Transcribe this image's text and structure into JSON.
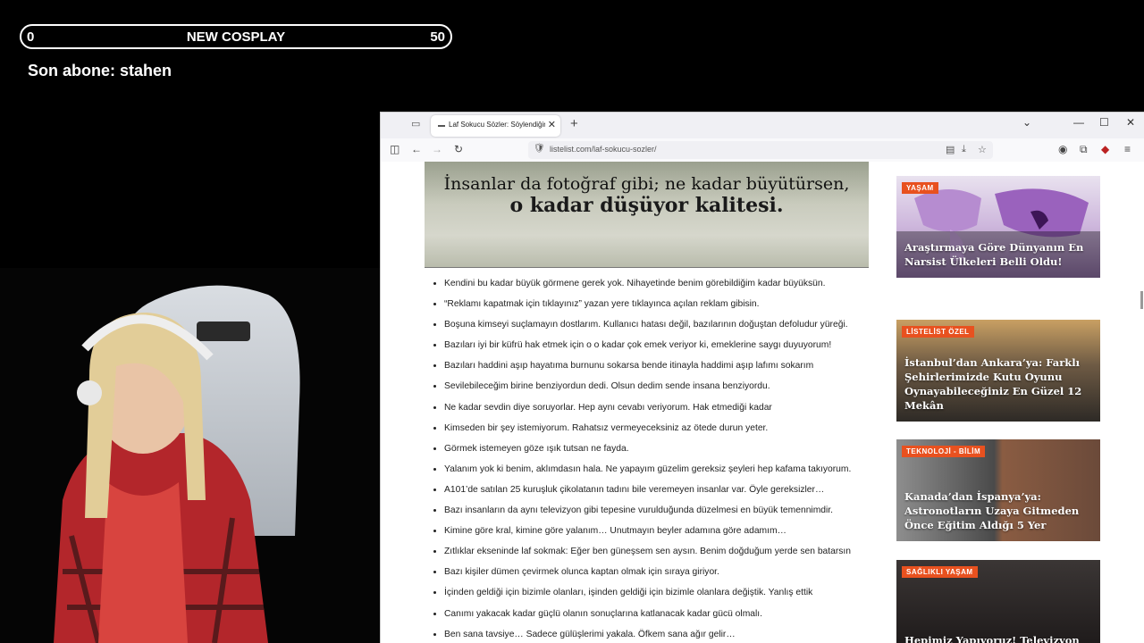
{
  "overlay": {
    "goal_min": "0",
    "goal_title": "NEW COSPLAY",
    "goal_max": "50",
    "last_sub": "Son abone: stahen"
  },
  "browser": {
    "tab_title": "Laf Sokucu Sözler: Söylendiğinde",
    "url": "listelist.com/laf-sokucu-sozler/"
  },
  "article": {
    "hero_line1": "İnsanlar da fotoğraf gibi; ne kadar büyütürsen,",
    "hero_line2": "o kadar düşüyor kalitesi.",
    "quotes": [
      "Kendini bu kadar büyük görmene gerek yok. Nihayetinde benim görebildiğim kadar büyüksün.",
      "“Reklamı kapatmak için tıklayınız” yazan yere tıklayınca açılan reklam gibisin.",
      "Boşuna kimseyi suçlamayın dostlarım. Kullanıcı hatası değil, bazılarının doğuştan defoludur yüreği.",
      "Bazıları iyi bir küfrü hak etmek için o o kadar çok emek veriyor ki, emeklerine saygı duyuyorum!",
      "Bazıları haddini aşıp hayatıma burnunu sokarsa bende itinayla haddimi aşıp lafımı sokarım",
      "Sevilebileceğim birine benziyordun dedi. Olsun dedim sende insana benziyordu.",
      "Ne kadar sevdin diye soruyorlar. Hep aynı cevabı veriyorum. Hak etmediği kadar",
      "Kimseden bir şey istemiyorum. Rahatsız vermeyeceksiniz az ötede durun yeter.",
      "Görmek istemeyen göze ışık tutsan ne fayda.",
      "Yalanım yok ki benim, aklımdasın hala. Ne yapayım güzelim gereksiz şeyleri hep kafama takıyorum.",
      "A101’de satılan 25 kuruşluk çikolatanın tadını bile veremeyen insanlar var. Öyle gereksizler…",
      "Bazı insanların da aynı televizyon gibi tepesine vurulduğunda düzelmesi en büyük temennimdir.",
      "Kimine göre kral, kimine göre yalanım… Unutmayın beyler adamına göre adamım…",
      "Zıtlıklar ekseninde laf sokmak: Eğer ben güneşsem sen aysın. Benim doğduğum yerde sen batarsın",
      "Bazı kişiler dümen çevirmek olunca kaptan olmak için sıraya giriyor.",
      "İçinden geldiği için bizimle olanları, işinden geldiği için bizimle olanlara değiştik. Yanlış ettik",
      "Canımı yakacak kadar güçlü olanın sonuçlarına katlanacak kadar gücü olmalı.",
      "Ben sana tavsiye… Sadece gülüşlerimi yakala. Öfkem sana ağır gelir…"
    ]
  },
  "sidebar": [
    {
      "tag": "YAŞAM",
      "headline": "Araştırmaya Göre Dünyanın En Narsist Ülkeleri Belli Oldu!"
    },
    {
      "tag": "LİSTELİST ÖZEL",
      "headline": "İstanbul’dan Ankara’ya: Farklı Şehirlerimizde Kutu Oyunu Oynayabileceğiniz En Güzel 12 Mekân"
    },
    {
      "tag": "TEKNOLOJİ - BİLİM",
      "headline": "Kanada’dan İspanya’ya: Astronotların Uzaya Gitmeden Önce Eğitim Aldığı 5 Yer"
    },
    {
      "tag": "SAĞLIKLI YAŞAM",
      "headline": "Hepimiz Yapıyoruz! Televizyon"
    }
  ],
  "colors": {
    "tag_bg": "#e8511f",
    "overlay_text": "#ffffff"
  }
}
